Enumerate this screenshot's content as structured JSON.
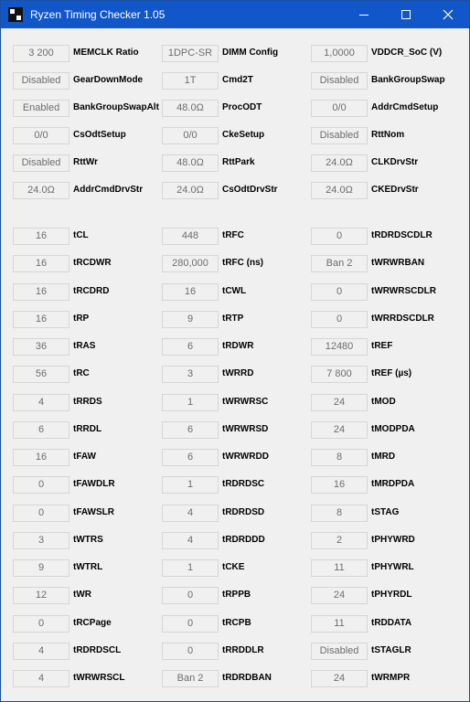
{
  "window": {
    "title": "Ryzen Timing Checker 1.05"
  },
  "config": [
    [
      {
        "value": "3 200",
        "label": "MEMCLK Ratio"
      },
      {
        "value": "1DPC-SR",
        "label": "DIMM Config"
      },
      {
        "value": "1,0000",
        "label": "VDDCR_SoC (V)"
      }
    ],
    [
      {
        "value": "Disabled",
        "label": "GearDownMode"
      },
      {
        "value": "1T",
        "label": "Cmd2T"
      },
      {
        "value": "Disabled",
        "label": "BankGroupSwap"
      }
    ],
    [
      {
        "value": "Enabled",
        "label": "BankGroupSwapAlt"
      },
      {
        "value": "48.0Ω",
        "label": "ProcODT"
      },
      {
        "value": "0/0",
        "label": "AddrCmdSetup"
      }
    ],
    [
      {
        "value": "0/0",
        "label": "CsOdtSetup"
      },
      {
        "value": "0/0",
        "label": "CkeSetup"
      },
      {
        "value": "Disabled",
        "label": "RttNom"
      }
    ],
    [
      {
        "value": "Disabled",
        "label": "RttWr"
      },
      {
        "value": "48.0Ω",
        "label": "RttPark"
      },
      {
        "value": "24.0Ω",
        "label": "CLKDrvStr"
      }
    ],
    [
      {
        "value": "24.0Ω",
        "label": "AddrCmdDrvStr"
      },
      {
        "value": "24.0Ω",
        "label": "CsOdtDrvStr"
      },
      {
        "value": "24.0Ω",
        "label": "CKEDrvStr"
      }
    ]
  ],
  "timings": [
    [
      {
        "value": "16",
        "label": "tCL"
      },
      {
        "value": "448",
        "label": "tRFC"
      },
      {
        "value": "0",
        "label": "tRDRDSCDLR"
      }
    ],
    [
      {
        "value": "16",
        "label": "tRCDWR"
      },
      {
        "value": "280,000",
        "label": "tRFC (ns)"
      },
      {
        "value": "Ban 2",
        "label": "tWRWRBAN"
      }
    ],
    [
      {
        "value": "16",
        "label": "tRCDRD"
      },
      {
        "value": "16",
        "label": "tCWL"
      },
      {
        "value": "0",
        "label": "tWRWRSCDLR"
      }
    ],
    [
      {
        "value": "16",
        "label": "tRP"
      },
      {
        "value": "9",
        "label": "tRTP"
      },
      {
        "value": "0",
        "label": "tWRRDSCDLR"
      }
    ],
    [
      {
        "value": "36",
        "label": "tRAS"
      },
      {
        "value": "6",
        "label": "tRDWR"
      },
      {
        "value": "12480",
        "label": "tREF"
      }
    ],
    [
      {
        "value": "56",
        "label": "tRC"
      },
      {
        "value": "3",
        "label": "tWRRD"
      },
      {
        "value": "7 800",
        "label": "tREF (µs)"
      }
    ],
    [
      {
        "value": "4",
        "label": "tRRDS"
      },
      {
        "value": "1",
        "label": "tWRWRSC"
      },
      {
        "value": "24",
        "label": "tMOD"
      }
    ],
    [
      {
        "value": "6",
        "label": "tRRDL"
      },
      {
        "value": "6",
        "label": "tWRWRSD"
      },
      {
        "value": "24",
        "label": "tMODPDA"
      }
    ],
    [
      {
        "value": "16",
        "label": "tFAW"
      },
      {
        "value": "6",
        "label": "tWRWRDD"
      },
      {
        "value": "8",
        "label": "tMRD"
      }
    ],
    [
      {
        "value": "0",
        "label": "tFAWDLR"
      },
      {
        "value": "1",
        "label": "tRDRDSC"
      },
      {
        "value": "16",
        "label": "tMRDPDA"
      }
    ],
    [
      {
        "value": "0",
        "label": "tFAWSLR"
      },
      {
        "value": "4",
        "label": "tRDRDSD"
      },
      {
        "value": "8",
        "label": "tSTAG"
      }
    ],
    [
      {
        "value": "3",
        "label": "tWTRS"
      },
      {
        "value": "4",
        "label": "tRDRDDD"
      },
      {
        "value": "2",
        "label": "tPHYWRD"
      }
    ],
    [
      {
        "value": "9",
        "label": "tWTRL"
      },
      {
        "value": "1",
        "label": "tCKE"
      },
      {
        "value": "11",
        "label": "tPHYWRL"
      }
    ],
    [
      {
        "value": "12",
        "label": "tWR"
      },
      {
        "value": "0",
        "label": "tRPPB"
      },
      {
        "value": "24",
        "label": "tPHYRDL"
      }
    ],
    [
      {
        "value": "0",
        "label": "tRCPage"
      },
      {
        "value": "0",
        "label": "tRCPB"
      },
      {
        "value": "11",
        "label": "tRDDATA"
      }
    ],
    [
      {
        "value": "4",
        "label": "tRDRDSCL"
      },
      {
        "value": "0",
        "label": "tRRDDLR"
      },
      {
        "value": "Disabled",
        "label": "tSTAGLR"
      }
    ],
    [
      {
        "value": "4",
        "label": "tWRWRSCL"
      },
      {
        "value": "Ban 2",
        "label": "tRDRDBAN"
      },
      {
        "value": "24",
        "label": "tWRMPR"
      }
    ]
  ]
}
